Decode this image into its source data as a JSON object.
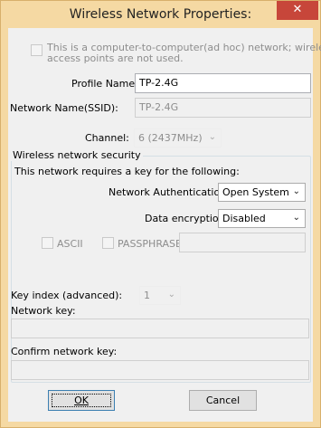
{
  "window": {
    "title": "Wireless Network Properties:",
    "close_glyph": "✕"
  },
  "adhoc": {
    "line1": "This is a computer-to-computer(ad hoc) network; wireless",
    "line2": "access points are not used.",
    "checked": false
  },
  "profile": {
    "label": "Profile Name:",
    "value": "TP-2.4G"
  },
  "ssid": {
    "label": "Network Name(SSID):",
    "value": "TP-2.4G"
  },
  "channel": {
    "label": "Channel:",
    "value": "6  (2437MHz)"
  },
  "security": {
    "legend": "Wireless network security",
    "requires_text": "This network requires a key for the following:",
    "auth_label": "Network Authentication:",
    "auth_value": "Open System",
    "encryption_label": "Data encryption:",
    "encryption_value": "Disabled",
    "ascii_label": "ASCII",
    "passphrase_label": "PASSPHRASE",
    "passphrase_value": "",
    "key_index_label": "Key index (advanced):",
    "key_index_value": "1",
    "network_key_label": "Network key:",
    "network_key_value": "",
    "confirm_key_label": "Confirm network key:",
    "confirm_key_value": ""
  },
  "buttons": {
    "ok_label": "OK",
    "cancel_label": "Cancel"
  },
  "icons": {
    "chevron": "chevron-down-icon",
    "close": "close-icon"
  },
  "colors": {
    "titlebar": "#f5d9a3",
    "close": "#c7463a",
    "client": "#f0f0f0"
  }
}
